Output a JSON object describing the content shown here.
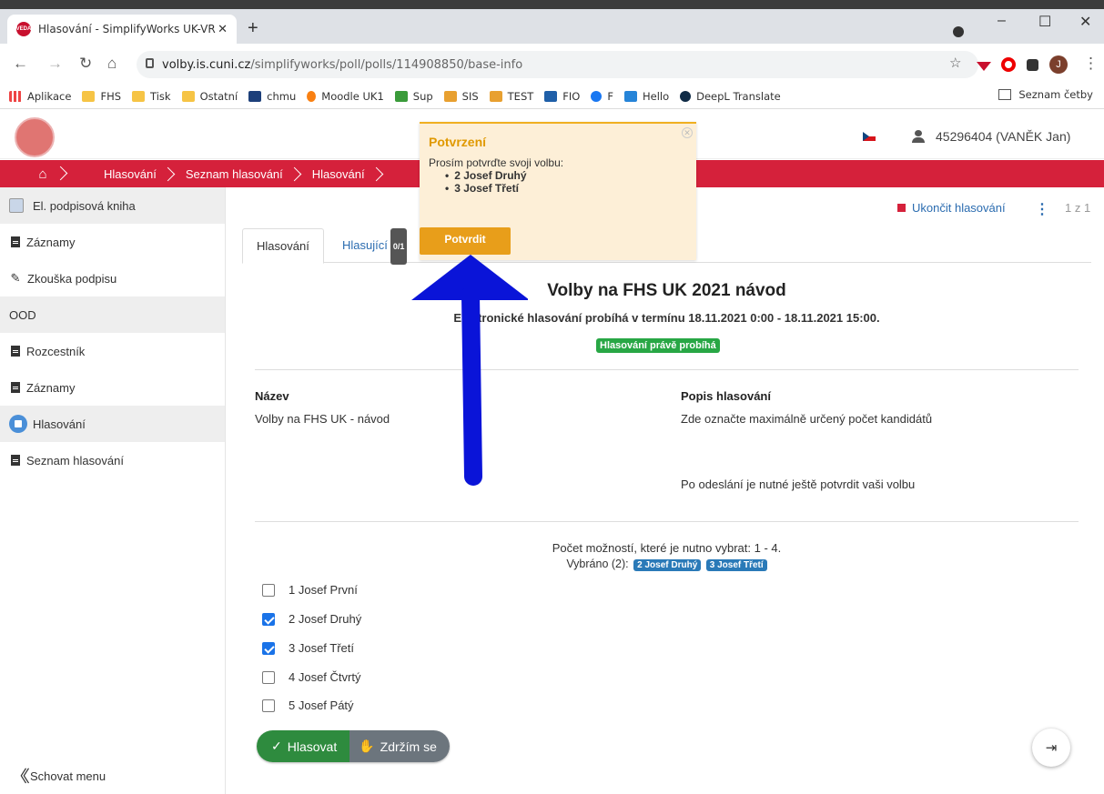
{
  "browser": {
    "tab_title": "Hlasování - SimplifyWorks UK-VR",
    "tab_close": "✕",
    "new_tab": "+",
    "favicon_text": "VEDA",
    "url_host": "volby.is.cuni.cz",
    "url_path": "/simplifyworks/poll/polls/114908850/base-info",
    "bookmarks": [
      "Aplikace",
      "FHS",
      "Tisk",
      "Ostatní",
      "chmu",
      "Moodle UK1",
      "Sup",
      "SIS",
      "TEST",
      "FIO",
      "F",
      "Hello",
      "DeepL Translate"
    ],
    "reading_list": "Seznam četby",
    "profile_initial": "J",
    "window_controls": [
      "–",
      "☐",
      "✕"
    ]
  },
  "header": {
    "user": "45296404 (VANĚK Jan)"
  },
  "breadcrumb": [
    "Hlasování",
    "Seznam hlasování",
    "Hlasování"
  ],
  "sidebar": {
    "items": [
      {
        "label": "El. podpisová kniha",
        "style": "grey",
        "icon": "book-icon"
      },
      {
        "label": "Záznamy",
        "style": "",
        "icon": "document-icon"
      },
      {
        "label": "Zkouška podpisu",
        "style": "",
        "icon": "pencil-icon"
      },
      {
        "label": "OOD",
        "style": "grey",
        "icon": ""
      },
      {
        "label": "Rozcestník",
        "style": "",
        "icon": "document-icon"
      },
      {
        "label": "Záznamy",
        "style": "",
        "icon": "document-icon"
      },
      {
        "label": "Hlasování",
        "style": "grey",
        "icon": "ballot-icon"
      },
      {
        "label": "Seznam hlasování",
        "style": "",
        "icon": "document-icon"
      }
    ],
    "hide_menu": "Schovat menu"
  },
  "toolbar": {
    "end_vote": "Ukončit hlasování",
    "page_count": "1 z 1"
  },
  "tabs": {
    "voting": "Hlasování",
    "voters": "Hlasující",
    "voters_count": "0/1"
  },
  "poll": {
    "title": "Volby na FHS UK 2021 návod",
    "period": "Elektronické hlasování probíhá v termínu 18.11.2021 0:00 - 18.11.2021 15:00.",
    "status": "Hlasování právě probíhá",
    "name_label": "Název",
    "name_value": "Volby na FHS UK - návod",
    "desc_label": "Popis hlasování",
    "desc_line1": "Zde označte maximálně určený počet kandidátů",
    "desc_line2": "Po odeslání je nutné ještě potvrdit vaši volbu",
    "need_select": "Počet možností, které je nutno vybrat: 1 - 4.",
    "selected_prefix": "Vybráno (2):",
    "selected": [
      "2 Josef Druhý",
      "3 Josef Třetí"
    ],
    "options": [
      {
        "label": "1 Josef První",
        "checked": false
      },
      {
        "label": "2 Josef Druhý",
        "checked": true
      },
      {
        "label": "3 Josef Třetí",
        "checked": true
      },
      {
        "label": "4 Josef Čtvrtý",
        "checked": false
      },
      {
        "label": "5 Josef Pátý",
        "checked": false
      }
    ],
    "vote_button": "Hlasovat",
    "abstain_button": "Zdržím se"
  },
  "confirm": {
    "title": "Potvrzení",
    "text": "Prosím potvrďte svoji volbu:",
    "items": [
      "2 Josef Druhý",
      "3 Josef Třetí"
    ],
    "button": "Potvrdit"
  },
  "colors": {
    "brand_red": "#d5213b",
    "link_blue": "#2b6cb0",
    "confirm_orange": "#e89e1a",
    "annotation_arrow": "#0a14d8"
  }
}
